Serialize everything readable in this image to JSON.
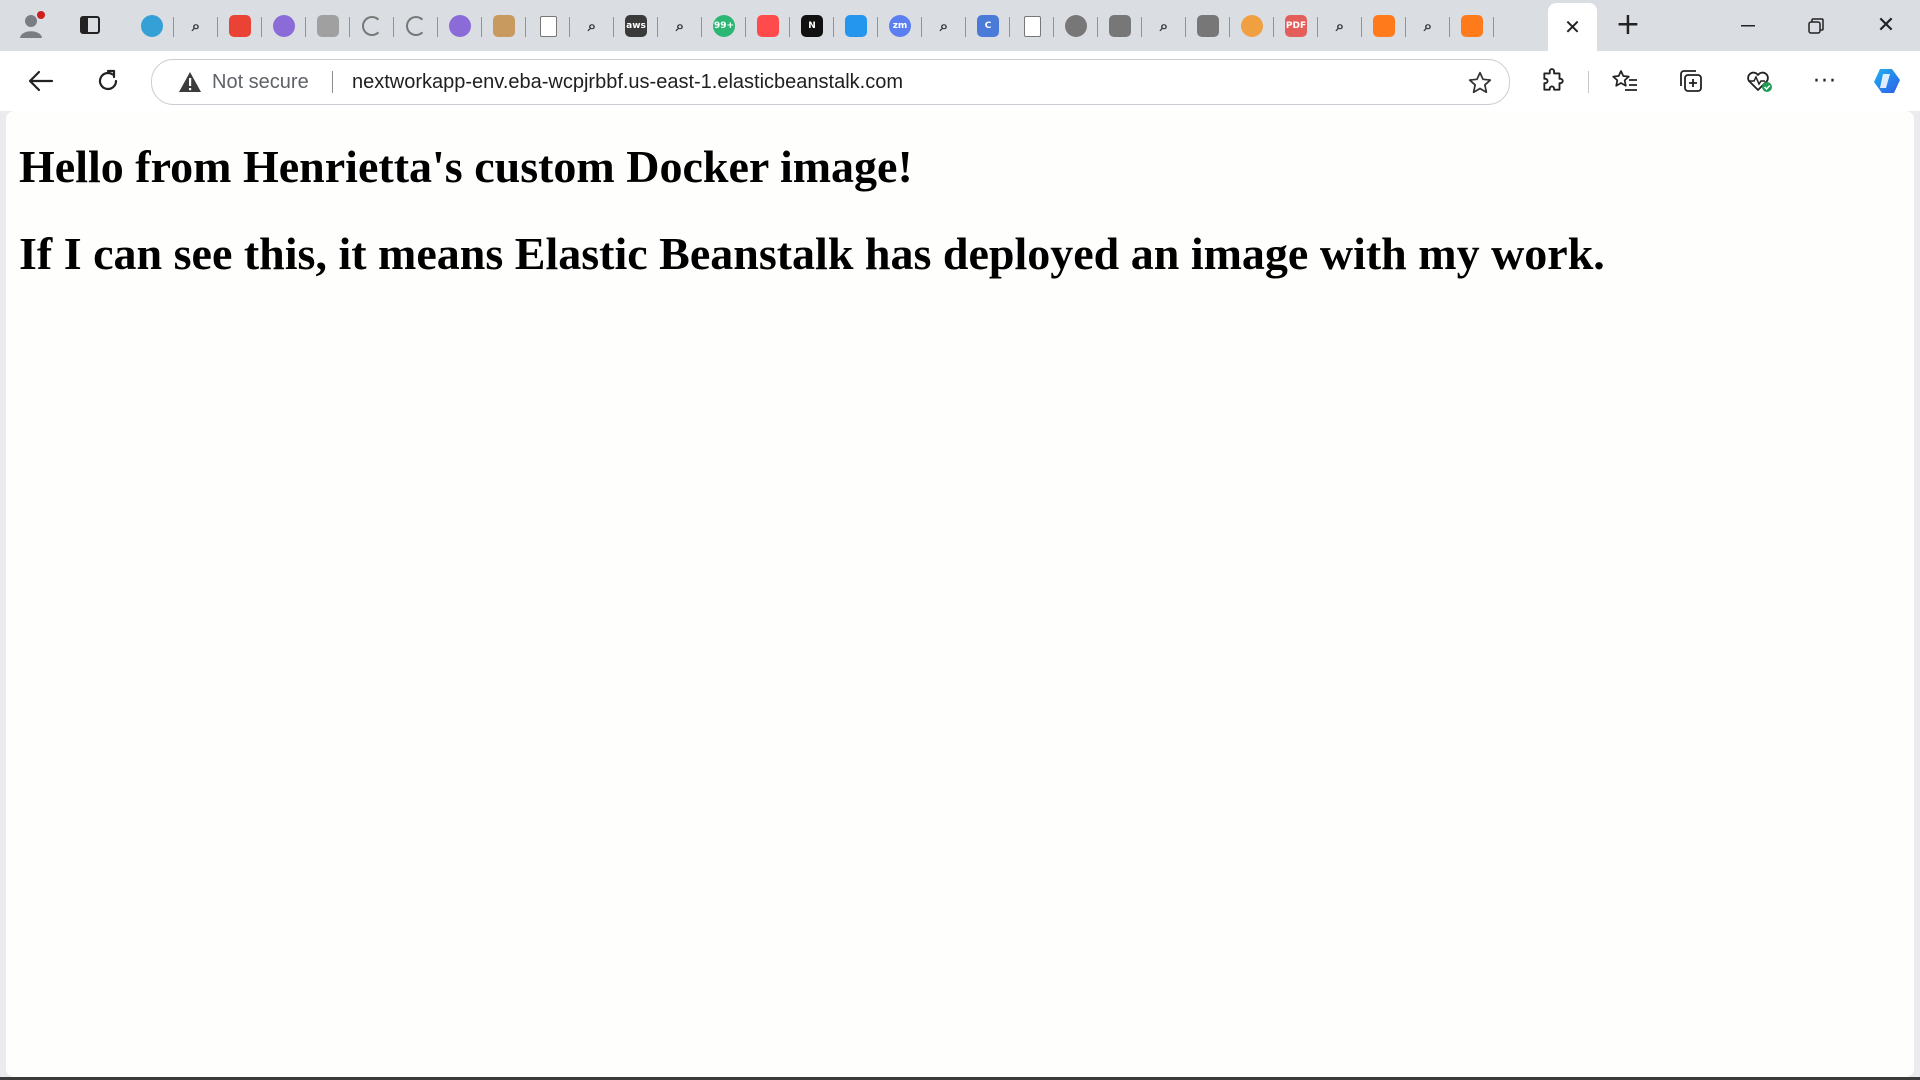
{
  "browser": {
    "tabs": [
      {
        "icon": "edge-icon",
        "color": "#34a0d6"
      },
      {
        "icon": "search-icon"
      },
      {
        "icon": "gmail-icon",
        "color": "#ea4335"
      },
      {
        "icon": "copilot-icon",
        "color": "#8a6bd8"
      },
      {
        "icon": "bookmark-icon",
        "color": "#a0a0a0"
      },
      {
        "icon": "loading-icon"
      },
      {
        "icon": "loading-icon"
      },
      {
        "icon": "copilot-icon",
        "color": "#8a6bd8"
      },
      {
        "icon": "cloud-icon",
        "color": "#c89a60"
      },
      {
        "icon": "page-icon"
      },
      {
        "icon": "search-icon"
      },
      {
        "icon": "aws-icon",
        "color": "#3a3a3a",
        "text": "aws"
      },
      {
        "icon": "search-icon"
      },
      {
        "icon": "chat-icon",
        "color": "#2bb673",
        "text": "99+"
      },
      {
        "icon": "youtube-icon",
        "color": "#ff4b4b"
      },
      {
        "icon": "notion-icon",
        "color": "#111111",
        "text": "N"
      },
      {
        "icon": "docker-icon",
        "color": "#2496ed"
      },
      {
        "icon": "zoom-icon",
        "color": "#5b7ff0",
        "text": "zm"
      },
      {
        "icon": "search-icon"
      },
      {
        "icon": "c-icon",
        "color": "#4a7bd8",
        "text": "C"
      },
      {
        "icon": "page-icon"
      },
      {
        "icon": "openai-icon",
        "color": "#777777"
      },
      {
        "icon": "terminal-icon",
        "color": "#777777"
      },
      {
        "icon": "search-icon"
      },
      {
        "icon": "briefcase-icon",
        "color": "#777777"
      },
      {
        "icon": "people-icon",
        "color": "#f0a040"
      },
      {
        "icon": "pdf-icon",
        "color": "#e35d5b",
        "text": "PDF"
      },
      {
        "icon": "search-icon"
      },
      {
        "icon": "x-app-icon",
        "color": "#ff7a1a"
      },
      {
        "icon": "search-icon"
      },
      {
        "icon": "cloud-up-icon",
        "color": "#ff7a1a"
      }
    ],
    "address": {
      "security_label": "Not secure",
      "url": "nextworkapp-env.eba-wcpjrbbf.us-east-1.elasticbeanstalk.com"
    }
  },
  "page": {
    "heading_1": "Hello from Henrietta's custom Docker image!",
    "heading_2": "If I can see this, it means Elastic Beanstalk has deployed an image with my work."
  }
}
